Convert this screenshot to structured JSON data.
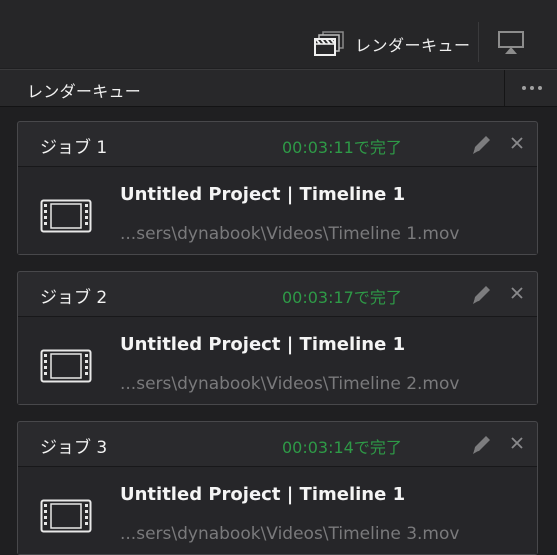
{
  "topbar": {
    "render_queue_label": "レンダーキュー",
    "render_queue_icon": "render-queue-clapper-icon",
    "monitor_icon": "output-monitor-icon"
  },
  "panel": {
    "title": "レンダーキュー",
    "more_icon": "more-options-icon"
  },
  "jobs": [
    {
      "name": "ジョブ 1",
      "status": "00:03:11で完了",
      "title": "Untitled Project | Timeline 1",
      "path": "...sers\\dynabook\\Videos\\Timeline 1.mov"
    },
    {
      "name": "ジョブ 2",
      "status": "00:03:17で完了",
      "title": "Untitled Project | Timeline 1",
      "path": "...sers\\dynabook\\Videos\\Timeline 2.mov"
    },
    {
      "name": "ジョブ 3",
      "status": "00:03:14で完了",
      "title": "Untitled Project | Timeline 1",
      "path": "...sers\\dynabook\\Videos\\Timeline 3.mov"
    }
  ],
  "colors": {
    "status_complete": "#2e9a47",
    "background": "#1f1f21",
    "card": "#2a2a2d"
  }
}
